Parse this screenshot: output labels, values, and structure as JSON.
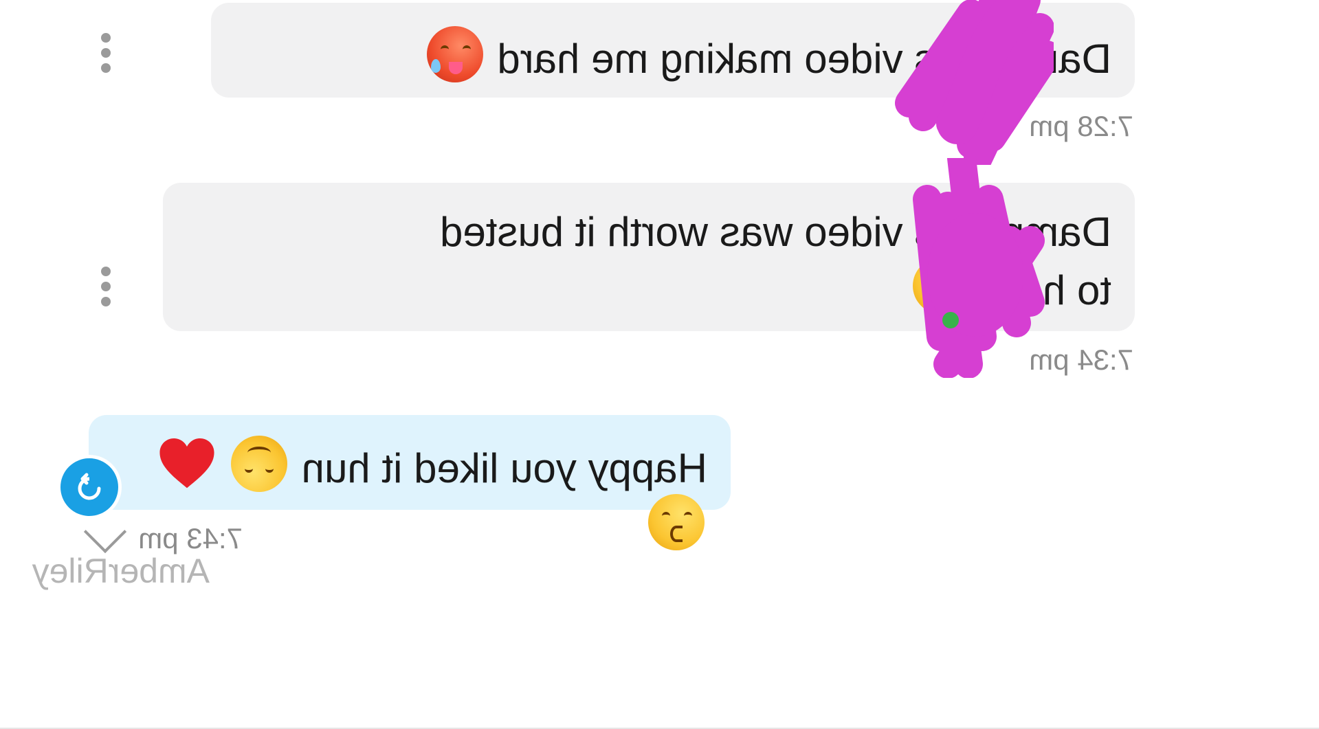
{
  "conversation": {
    "messages": [
      {
        "direction": "incoming",
        "text": "Damm this video making me hard",
        "emoji": [
          "hot-face-emoji"
        ],
        "time": "7:28 pm"
      },
      {
        "direction": "incoming",
        "text_line1": "Damm this video was worth it busted",
        "text_line2": "to hard",
        "emoji": [
          "smirking-face-emoji"
        ],
        "time": "7:34 pm"
      },
      {
        "direction": "outgoing",
        "text": "Happy you liked it hun",
        "emoji": [
          "upside-down-face-emoji",
          "red-heart-emoji",
          "kissing-face-emoji"
        ],
        "time": "7:43 pm"
      }
    ]
  },
  "watermark": "AmberRiley",
  "colors": {
    "incoming_bubble": "#f1f1f2",
    "outgoing_bubble": "#dff3fd",
    "accent": "#1aa0e4",
    "redaction": "#d63fd2",
    "timestamp": "#8a8a8a"
  },
  "icons": {
    "more": "more-vertical-icon",
    "forward": "forward-icon",
    "chevron": "chevron-down-icon"
  }
}
